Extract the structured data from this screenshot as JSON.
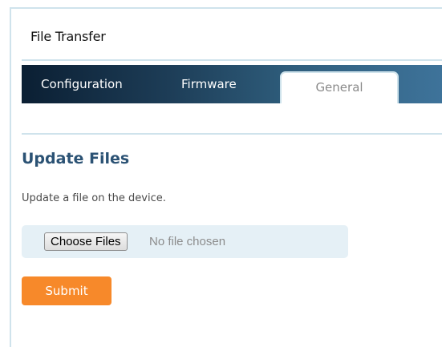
{
  "page": {
    "title": "File Transfer"
  },
  "tabs": [
    {
      "label": "Configuration",
      "active": false
    },
    {
      "label": "Firmware",
      "active": false
    },
    {
      "label": "General",
      "active": true
    }
  ],
  "section": {
    "heading": "Update Files",
    "description": "Update a file on the device."
  },
  "file_input": {
    "button_label": "Choose Files",
    "status_text": "No file chosen"
  },
  "actions": {
    "submit_label": "Submit"
  },
  "colors": {
    "accent_orange": "#f7892a",
    "heading_blue": "#2b5274",
    "tabbar_dark": "#0b1f33",
    "tabbar_light": "#3e739a",
    "rule_light_blue": "#cfe3ec",
    "file_row_bg": "#e5f0f6"
  }
}
